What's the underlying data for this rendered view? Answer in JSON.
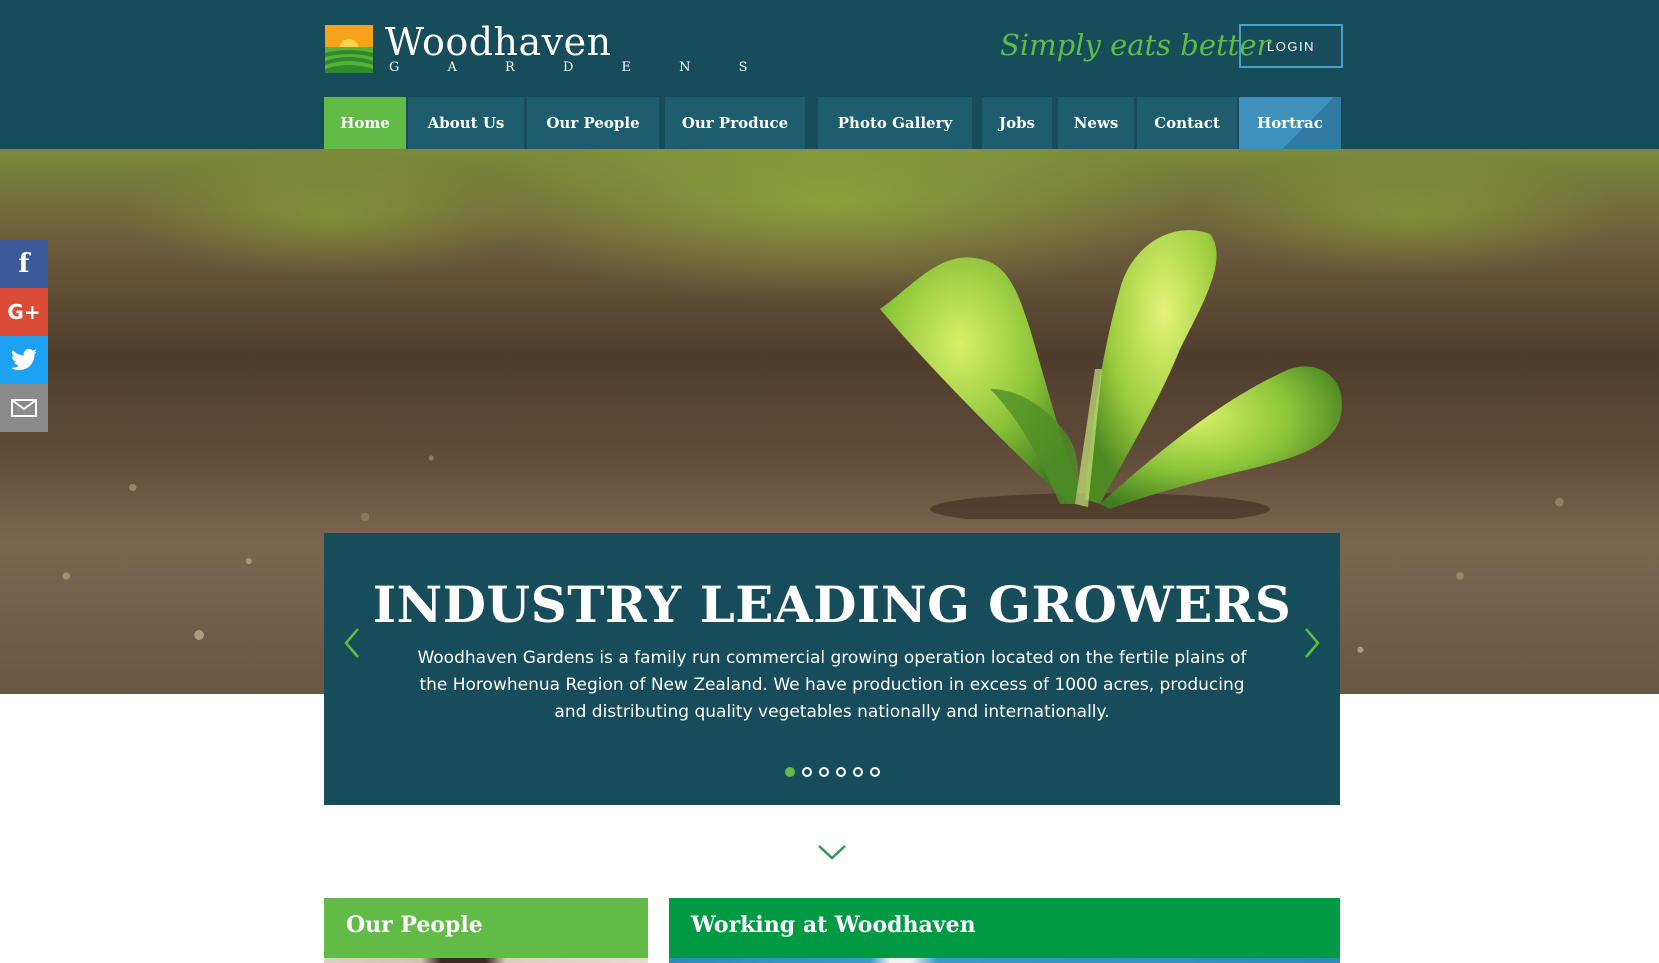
{
  "brand": {
    "name": "Woodhaven",
    "subtitle": "G A R D E N S",
    "tagline": "Simply eats better",
    "colors": {
      "header": "#174c5a",
      "accent_green": "#62bb46",
      "dark_green": "#009a44",
      "hortrac_blue": "#3f91bd"
    }
  },
  "header": {
    "login_label": "LOGIN"
  },
  "nav": {
    "items": [
      {
        "label": "Home",
        "active": true
      },
      {
        "label": "About Us"
      },
      {
        "label": "Our People"
      },
      {
        "label": "Our Produce"
      },
      {
        "label": "Photo Gallery"
      },
      {
        "label": "Jobs"
      },
      {
        "label": "News"
      },
      {
        "label": "Contact"
      },
      {
        "label": "Hortrac"
      }
    ]
  },
  "social": {
    "items": [
      {
        "icon": "facebook-icon",
        "glyph": "f"
      },
      {
        "icon": "google-plus-icon",
        "glyph": "G+"
      },
      {
        "icon": "twitter-icon",
        "glyph": ""
      },
      {
        "icon": "email-icon",
        "glyph": ""
      }
    ]
  },
  "slider": {
    "title": "INDUSTRY LEADING GROWERS",
    "text": "Woodhaven Gardens is a family run commercial growing operation located on the fertile plains of the Horowhenua Region of New Zealand. We have production in excess of 1000 acres, producing and distributing quality vegetables nationally and internationally.",
    "slide_count": 6,
    "active_slide": 1,
    "prev_icon": "chevron-left-icon",
    "next_icon": "chevron-right-icon"
  },
  "cards": {
    "people_title": "Our People",
    "working_title": "Working at Woodhaven"
  }
}
